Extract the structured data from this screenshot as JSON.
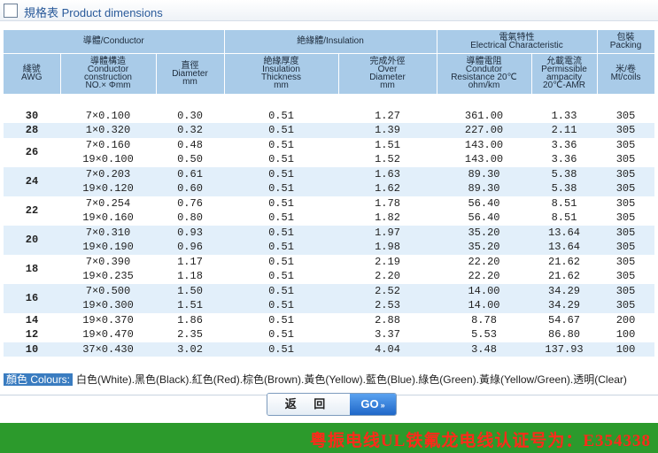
{
  "section": {
    "title": "規格表 Product dimensions"
  },
  "headers": {
    "conductor": "導體/Conductor",
    "insulation": "絶緣體/Insulation",
    "electrical_1": "電氣特性",
    "electrical_2": "Electrical Characteristic",
    "packing_1": "包裝",
    "packing_2": "Packing",
    "awg_1": "綫號",
    "awg_2": "AWG",
    "cons_1": "導體構造",
    "cons_2": "Conductor",
    "cons_3": "construction",
    "cons_4": "NO.× Φmm",
    "dia_1": "直徑",
    "dia_2": "Diameter",
    "dia_3": "mm",
    "thick_1": "絶緣厚度",
    "thick_2": "Insulation",
    "thick_3": "Thickness",
    "thick_4": "mm",
    "od_1": "完成外徑",
    "od_2": "Over",
    "od_3": "Diameter",
    "od_4": "mm",
    "res_1": "導體電阻",
    "res_2": "Condutor",
    "res_3": "Resistance 20℃",
    "res_4": "ohm/km",
    "amp_1": "允載電流",
    "amp_2": "Permissible",
    "amp_3": "ampacity",
    "amp_4": "20℃-AMR",
    "pack_1": "米/卷",
    "pack_2": "Mt/coils"
  },
  "rows": [
    {
      "awg": "30",
      "cons": "7×0.100",
      "dia": "0.30",
      "thick": "0.51",
      "od": "1.27",
      "res": "361.00",
      "amp": "1.33",
      "pack": "305"
    },
    {
      "awg": "28",
      "cons": "1×0.320",
      "dia": "0.32",
      "thick": "0.51",
      "od": "1.39",
      "res": "227.00",
      "amp": "2.11",
      "pack": "305"
    },
    {
      "awg": "",
      "cons": "7×0.160",
      "dia": "0.48",
      "thick": "0.51",
      "od": "1.51",
      "res": "143.00",
      "amp": "3.36",
      "pack": "305"
    },
    {
      "awg": "26",
      "cons": "19×0.100",
      "dia": "0.50",
      "thick": "0.51",
      "od": "1.52",
      "res": "143.00",
      "amp": "3.36",
      "pack": "305"
    },
    {
      "awg": "",
      "cons": "7×0.203",
      "dia": "0.61",
      "thick": "0.51",
      "od": "1.63",
      "res": "89.30",
      "amp": "5.38",
      "pack": "305"
    },
    {
      "awg": "24",
      "cons": "19×0.120",
      "dia": "0.60",
      "thick": "0.51",
      "od": "1.62",
      "res": "89.30",
      "amp": "5.38",
      "pack": "305"
    },
    {
      "awg": "",
      "cons": "7×0.254",
      "dia": "0.76",
      "thick": "0.51",
      "od": "1.78",
      "res": "56.40",
      "amp": "8.51",
      "pack": "305"
    },
    {
      "awg": "22",
      "cons": "19×0.160",
      "dia": "0.80",
      "thick": "0.51",
      "od": "1.82",
      "res": "56.40",
      "amp": "8.51",
      "pack": "305"
    },
    {
      "awg": "",
      "cons": "7×0.310",
      "dia": "0.93",
      "thick": "0.51",
      "od": "1.97",
      "res": "35.20",
      "amp": "13.64",
      "pack": "305"
    },
    {
      "awg": "20",
      "cons": "19×0.190",
      "dia": "0.96",
      "thick": "0.51",
      "od": "1.98",
      "res": "35.20",
      "amp": "13.64",
      "pack": "305"
    },
    {
      "awg": "",
      "cons": "7×0.390",
      "dia": "1.17",
      "thick": "0.51",
      "od": "2.19",
      "res": "22.20",
      "amp": "21.62",
      "pack": "305"
    },
    {
      "awg": "18",
      "cons": "19×0.235",
      "dia": "1.18",
      "thick": "0.51",
      "od": "2.20",
      "res": "22.20",
      "amp": "21.62",
      "pack": "305"
    },
    {
      "awg": "",
      "cons": "7×0.500",
      "dia": "1.50",
      "thick": "0.51",
      "od": "2.52",
      "res": "14.00",
      "amp": "34.29",
      "pack": "305"
    },
    {
      "awg": "16",
      "cons": "19×0.300",
      "dia": "1.51",
      "thick": "0.51",
      "od": "2.53",
      "res": "14.00",
      "amp": "34.29",
      "pack": "305"
    },
    {
      "awg": "14",
      "cons": "19×0.370",
      "dia": "1.86",
      "thick": "0.51",
      "od": "2.88",
      "res": "8.78",
      "amp": "54.67",
      "pack": "200"
    },
    {
      "awg": "12",
      "cons": "19×0.470",
      "dia": "2.35",
      "thick": "0.51",
      "od": "3.37",
      "res": "5.53",
      "amp": "86.80",
      "pack": "100"
    },
    {
      "awg": "10",
      "cons": "37×0.430",
      "dia": "3.02",
      "thick": "0.51",
      "od": "4.04",
      "res": "3.48",
      "amp": "137.93",
      "pack": "100"
    }
  ],
  "colours": {
    "label": "顏色 Colours:",
    "text": "白色(White).黑色(Black).紅色(Red).棕色(Brown).黃色(Yellow).藍色(Blue).綠色(Green).黃綠(Yellow/Green).透明(Clear)"
  },
  "nav": {
    "back_label": "返 回",
    "go_label": "GO",
    "go_arrow": "»"
  },
  "footer": {
    "text": "粤振电线UL铁氟龙电线认证号为：E354338"
  },
  "colors": {
    "header_bg": "#a9cbe8",
    "row_alt": "#e2effa",
    "footer_bg": "#2c9a2c",
    "footer_text": "#ff2a1a",
    "accent": "#3a7cc0"
  }
}
